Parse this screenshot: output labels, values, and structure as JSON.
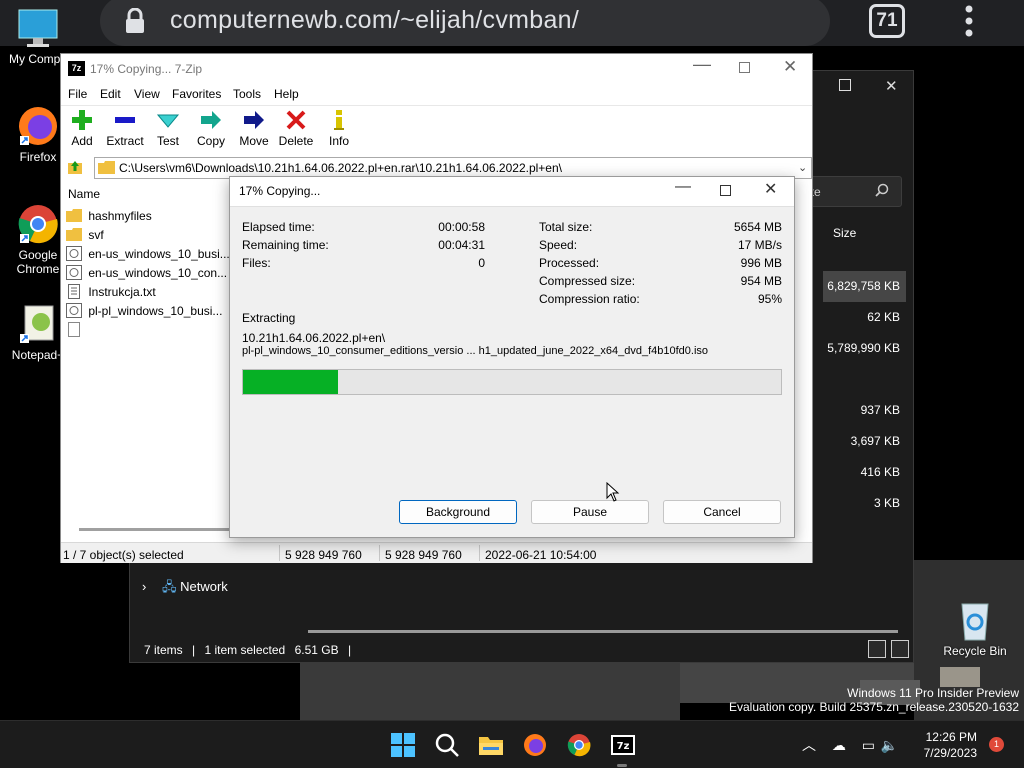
{
  "browser": {
    "url": "computernewb.com/~elijah/cvmban/",
    "tab_count": "71"
  },
  "desktop": {
    "icons": [
      {
        "label": "My Compu"
      },
      {
        "label": "Firefox"
      },
      {
        "label": "Google Chrome"
      },
      {
        "label": "Notepad+"
      },
      {
        "label": "Recycle Bin"
      }
    ],
    "watermark_line1": "Windows 11 Pro Insider Preview",
    "watermark_line2": "Evaluation copy. Build 25375.zn_release.230520-1632"
  },
  "explorer": {
    "search_label": "ute",
    "size_header": "Size",
    "sizes": [
      "6,829,758 KB",
      "62 KB",
      "5,789,990 KB",
      "",
      "937 KB",
      "3,697 KB",
      "416 KB",
      "3 KB"
    ],
    "network_label": "Network",
    "status_items": "7 items",
    "status_selected": "1 item selected",
    "status_size": "6.51 GB"
  },
  "zip": {
    "title": "17% Copying... 7-Zip",
    "menu": [
      "File",
      "Edit",
      "View",
      "Favorites",
      "Tools",
      "Help"
    ],
    "toolbar": [
      "Add",
      "Extract",
      "Test",
      "Copy",
      "Move",
      "Delete",
      "Info"
    ],
    "address": "C:\\Users\\vm6\\Downloads\\10.21h1.64.06.2022.pl+en.rar\\10.21h1.64.06.2022.pl+en\\",
    "column_name": "Name",
    "files": [
      {
        "name": "hashmyfiles",
        "type": "folder"
      },
      {
        "name": "svf",
        "type": "folder"
      },
      {
        "name": "en-us_windows_10_busi...",
        "type": "iso"
      },
      {
        "name": "en-us_windows_10_con...",
        "type": "iso"
      },
      {
        "name": "Instrukcja.txt",
        "type": "txt"
      },
      {
        "name": "pl-pl_windows_10_busi...",
        "type": "iso"
      },
      {
        "name": "",
        "type": "blank"
      }
    ],
    "status": {
      "selected": "1 / 7 object(s) selected",
      "size": "5 928 949 760",
      "packed": "5 928 949 760",
      "modified": "2022-06-21 10:54:00"
    }
  },
  "dialog": {
    "title": "17% Copying...",
    "left_stats": [
      {
        "label": "Elapsed time:",
        "value": "00:00:58"
      },
      {
        "label": "Remaining time:",
        "value": "00:04:31"
      },
      {
        "label": "Files:",
        "value": "0"
      }
    ],
    "right_stats": [
      {
        "label": "Total size:",
        "value": "5654 MB"
      },
      {
        "label": "Speed:",
        "value": "17 MB/s"
      },
      {
        "label": "Processed:",
        "value": "996 MB"
      },
      {
        "label": "Compressed size:",
        "value": "954 MB"
      },
      {
        "label": "Compression ratio:",
        "value": "95%"
      }
    ],
    "operation": "Extracting",
    "path_line1": "10.21h1.64.06.2022.pl+en\\",
    "path_line2": "pl-pl_windows_10_consumer_editions_versio ... h1_updated_june_2022_x64_dvd_f4b10fd0.iso",
    "progress_percent": 17.6,
    "buttons": [
      "Background",
      "Pause",
      "Cancel"
    ]
  },
  "taskbar": {
    "time": "12:26 PM",
    "date": "7/29/2023",
    "notification_count": "1"
  }
}
